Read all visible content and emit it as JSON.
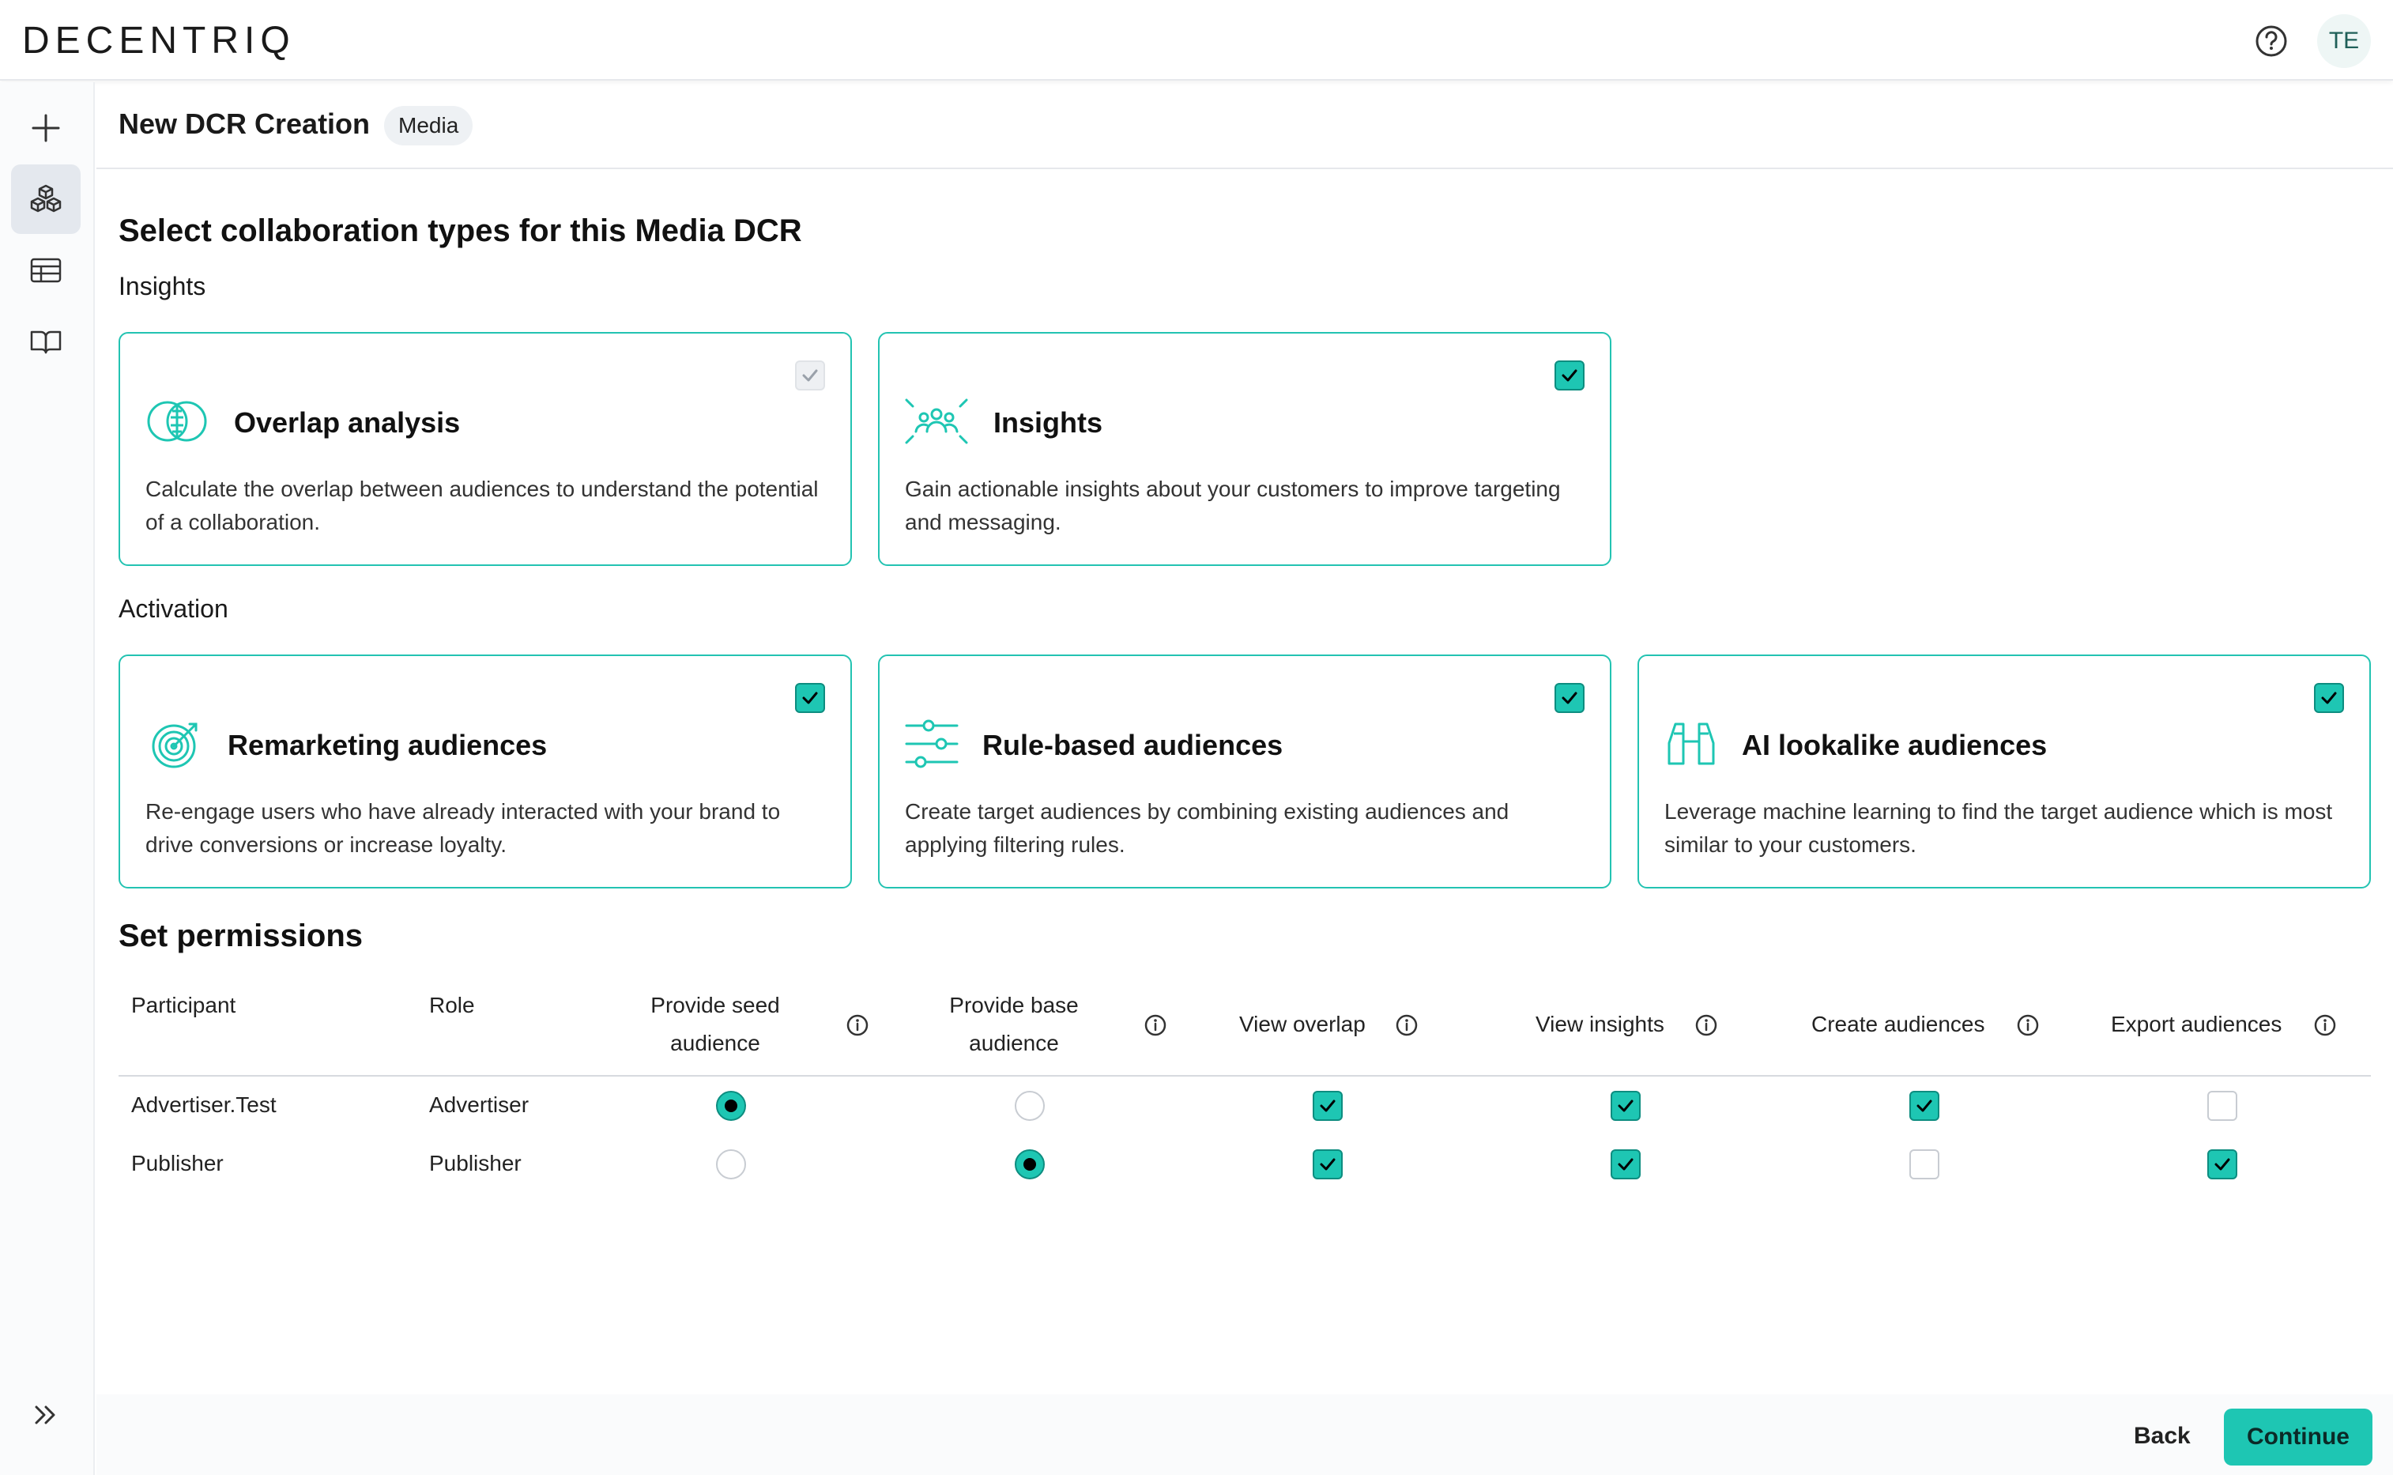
{
  "app": {
    "logo": "DECENTRIQ",
    "avatar_initials": "TE"
  },
  "header": {
    "title": "New DCR Creation",
    "badge": "Media"
  },
  "main": {
    "heading": "Select collaboration types for this Media DCR",
    "insights_label": "Insights",
    "activation_label": "Activation",
    "permissions_heading": "Set permissions"
  },
  "cards": {
    "overlap": {
      "title": "Overlap analysis",
      "desc": "Calculate the overlap between audiences to understand the potential of a collaboration.",
      "checked": true,
      "disabled": true,
      "icon": "overlap-circles-icon"
    },
    "insights": {
      "title": "Insights",
      "desc": "Gain actionable insights about your customers to improve targeting and messaging.",
      "checked": true,
      "icon": "people-insights-icon"
    },
    "remarketing": {
      "title": "Remarketing audiences",
      "desc": "Re-engage users who have already interacted with your brand to drive conversions or increase loyalty.",
      "checked": true,
      "icon": "target-icon"
    },
    "rule_based": {
      "title": "Rule-based audiences",
      "desc": "Create target audiences by combining existing audiences and applying filtering rules.",
      "checked": true,
      "icon": "sliders-icon"
    },
    "lookalike": {
      "title": "AI lookalike audiences",
      "desc": "Leverage machine learning to find the target audience which is most similar to your customers.",
      "checked": true,
      "icon": "binoculars-icon"
    }
  },
  "table": {
    "columns": {
      "participant": "Participant",
      "role": "Role",
      "seed": "Provide seed audience",
      "base": "Provide base audience",
      "overlap": "View overlap",
      "insights": "View insights",
      "create": "Create audiences",
      "export": "Export audiences"
    },
    "rows": [
      {
        "participant": "Advertiser.Test",
        "role": "Advertiser",
        "seed": true,
        "base": false,
        "overlap": true,
        "insights": true,
        "create": true,
        "export": false
      },
      {
        "participant": "Publisher",
        "role": "Publisher",
        "seed": false,
        "base": true,
        "overlap": true,
        "insights": true,
        "create": false,
        "export": true
      }
    ]
  },
  "footer": {
    "back_label": "Back",
    "continue_label": "Continue"
  },
  "colors": {
    "accent": "#1ec6b3",
    "accent_border": "#23c3b2",
    "text": "#111111"
  }
}
